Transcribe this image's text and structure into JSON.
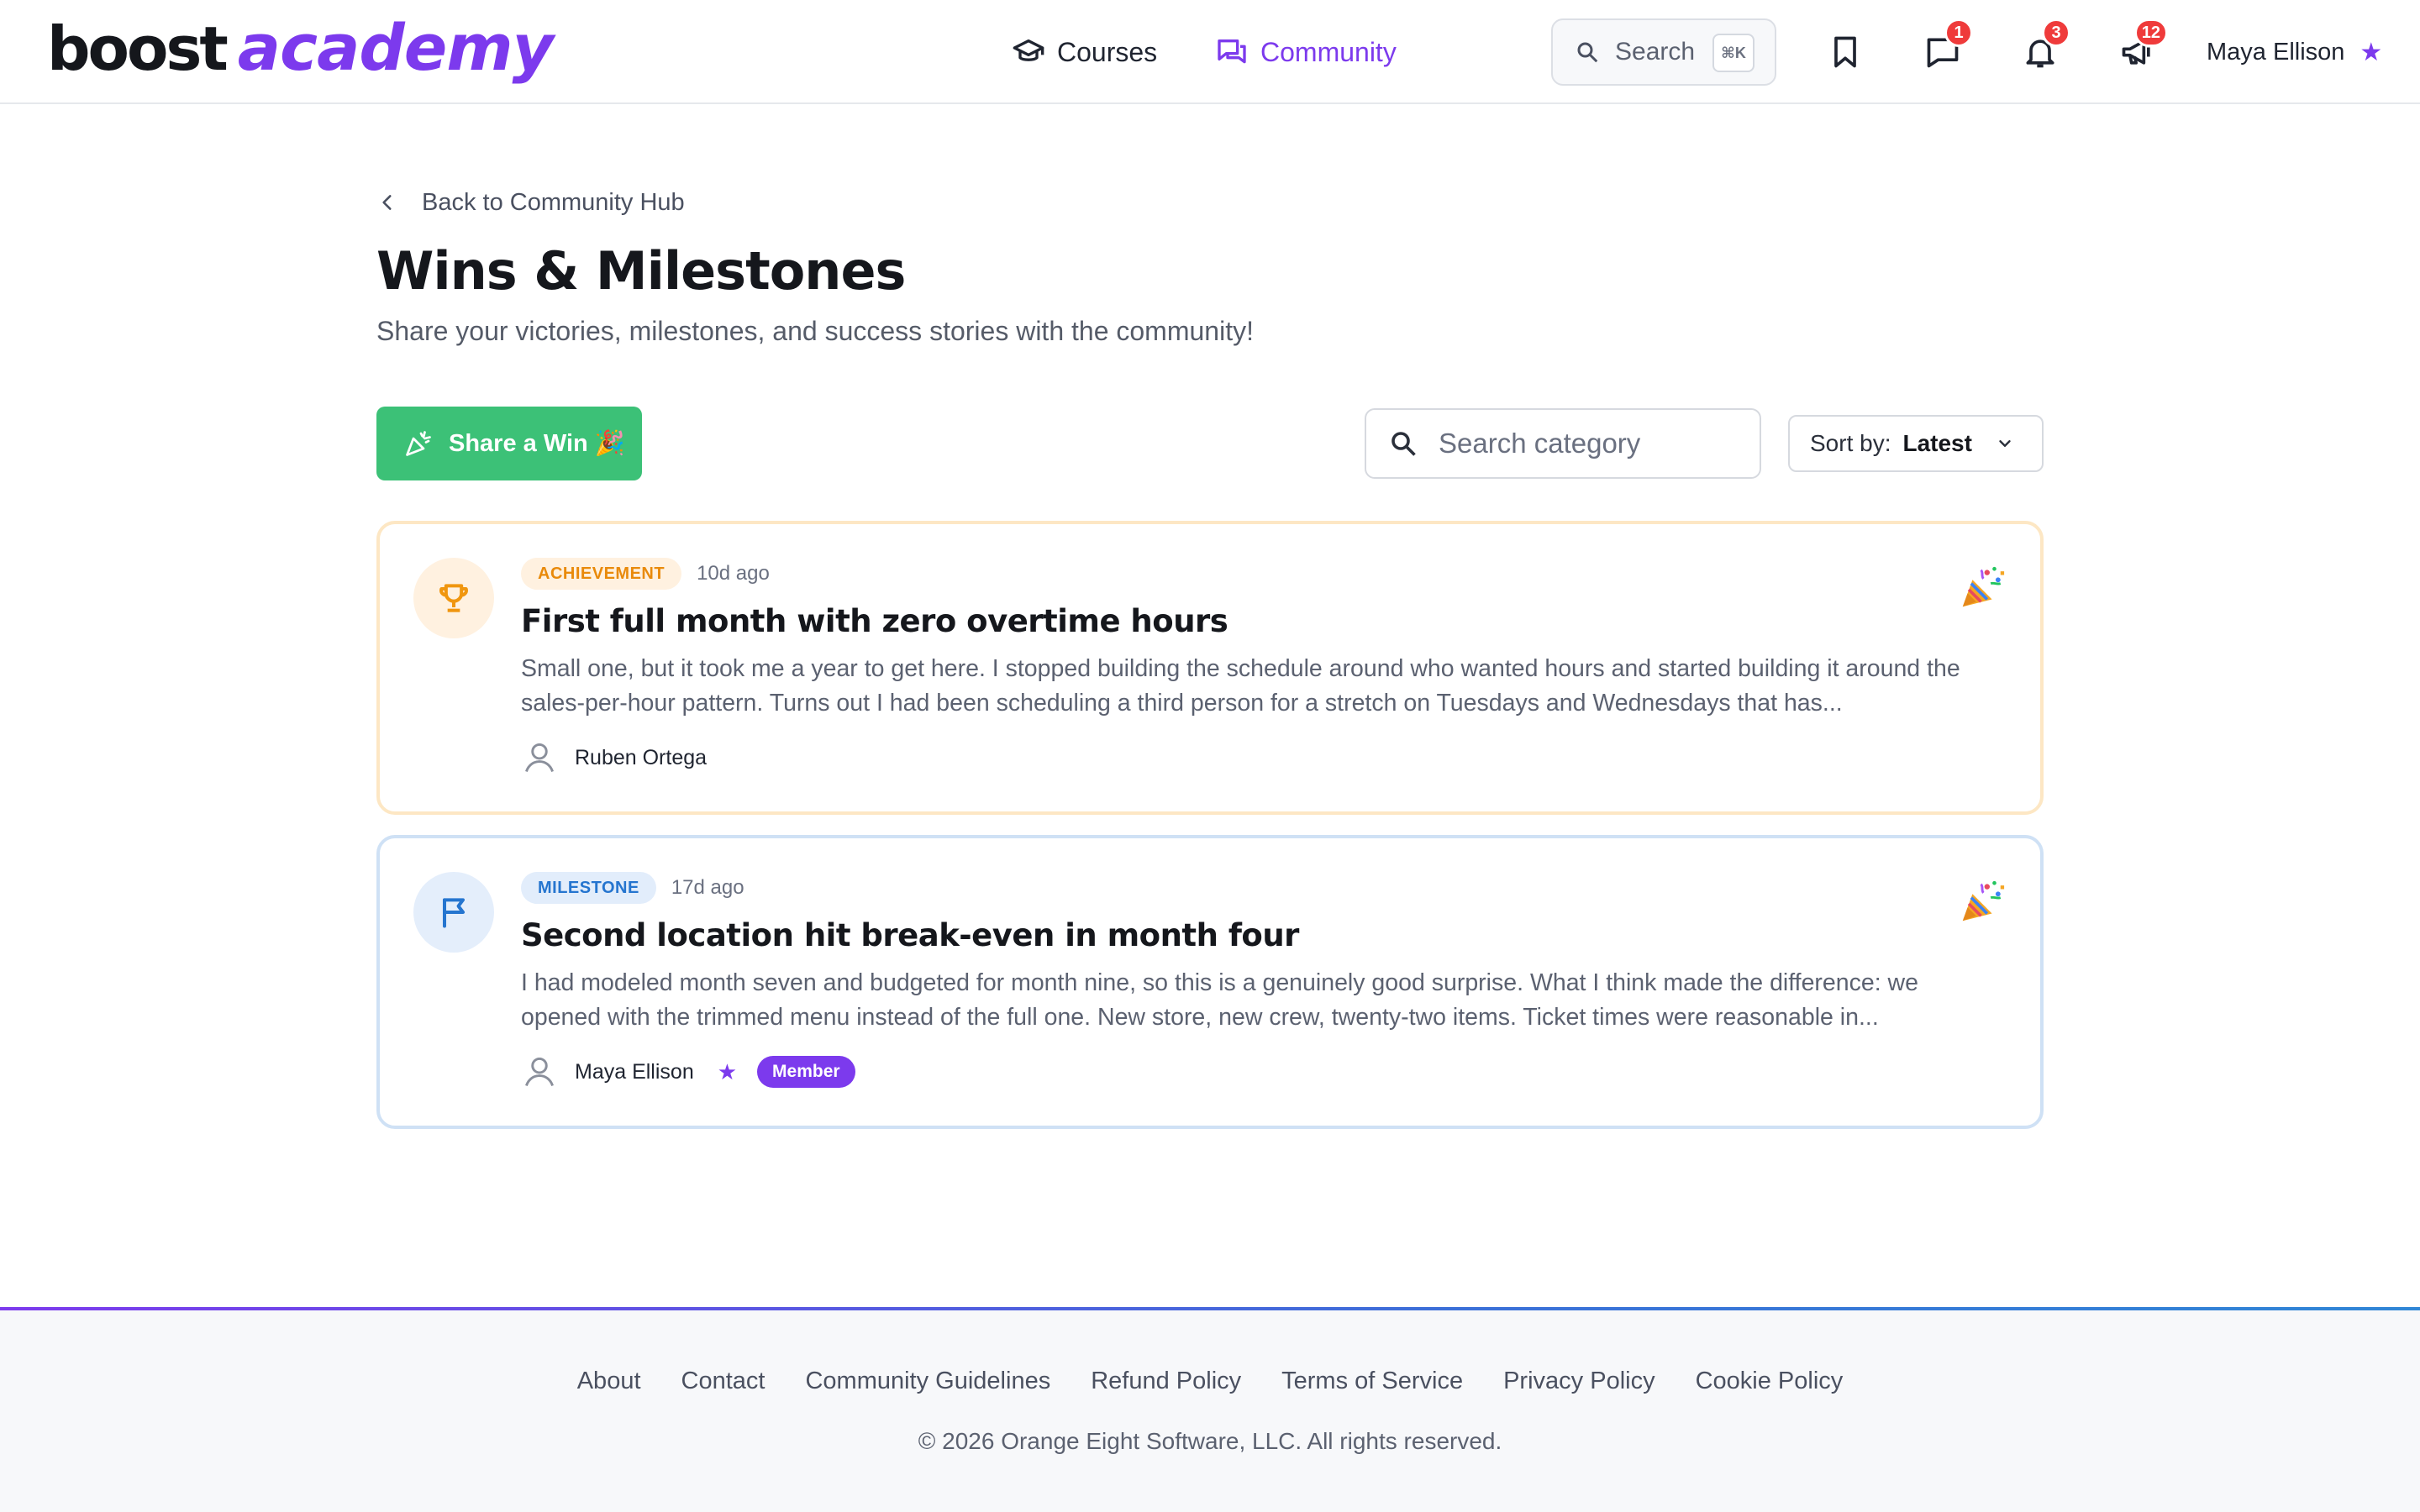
{
  "header": {
    "logo_part1": "boost",
    "logo_part2": "academy",
    "nav": [
      {
        "label": "Courses",
        "icon": "graduation-cap-icon"
      },
      {
        "label": "Community",
        "icon": "chat-bubbles-icon",
        "active": true
      }
    ],
    "search": {
      "label": "Search",
      "shortcut": "⌘K"
    },
    "icons": [
      {
        "name": "bookmark-icon"
      },
      {
        "name": "messages-icon",
        "badge": "1"
      },
      {
        "name": "bell-icon",
        "badge": "3"
      },
      {
        "name": "megaphone-icon",
        "badge": "12"
      }
    ],
    "user": {
      "name": "Maya Ellison"
    }
  },
  "page": {
    "back_label": "Back to Community Hub",
    "title": "Wins & Milestones",
    "subtitle": "Share your victories, milestones, and success stories with the community!",
    "share_button": "Share a Win 🎉",
    "search_placeholder": "Search category",
    "sort": {
      "label": "Sort by:",
      "value": "Latest"
    }
  },
  "posts": [
    {
      "tag": "ACHIEVEMENT",
      "time": "10d ago",
      "title": "First full month with zero overtime hours",
      "body": "Small one, but it took me a year to get here. I stopped building the schedule around who wanted hours and started building it around the sales-per-hour pattern. Turns out I had been scheduling a third person for a stretch on Tuesdays and Wednesdays that has...",
      "author": "Ruben Ortega"
    },
    {
      "tag": "MILESTONE",
      "time": "17d ago",
      "title": "Second location hit break-even in month four",
      "body": "I had modeled month seven and budgeted for month nine, so this is a genuinely good surprise. What I think made the difference: we opened with the trimmed menu instead of the full one. New store, new crew, twenty-two items. Ticket times were reasonable in...",
      "author": "Maya Ellison",
      "author_badge": "Member"
    }
  ],
  "footer": {
    "links": [
      "About",
      "Contact",
      "Community Guidelines",
      "Refund Policy",
      "Terms of Service",
      "Privacy Policy",
      "Cookie Policy"
    ],
    "copyright": "© 2026 Orange Eight Software, LLC. All rights reserved."
  },
  "colors": {
    "brand": "#7c3aed",
    "success": "#3cc177",
    "achievement": "#e98a0b",
    "milestone": "#2575cf",
    "badge": "#ef3b3b"
  }
}
